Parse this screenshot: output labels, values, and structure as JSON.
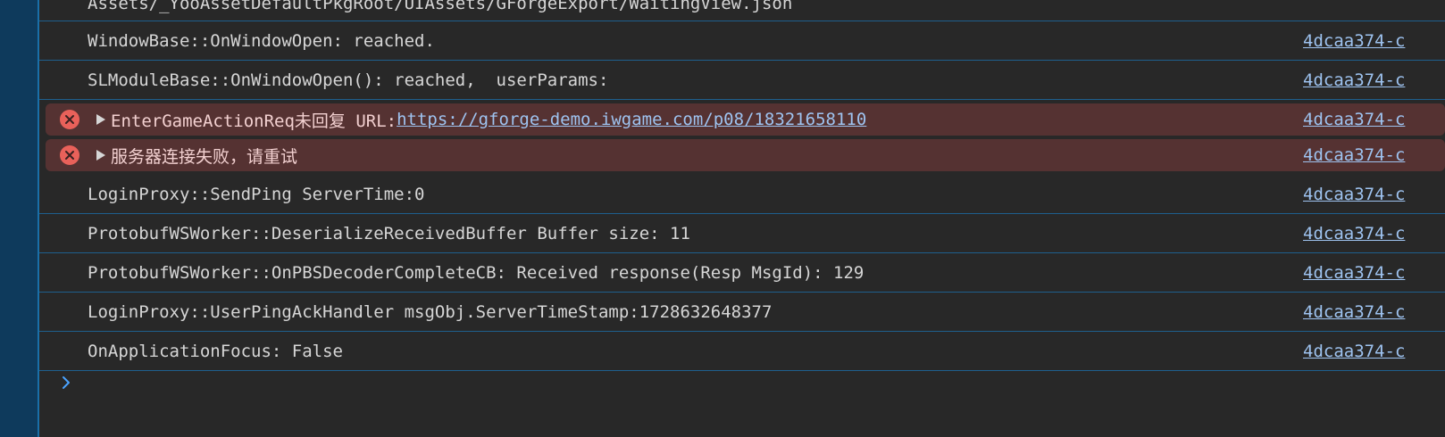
{
  "console": {
    "rows": [
      {
        "text": "Assets/_YooAssetDefaultPkgRoot/UIAssets/GForgeExport/WaitingView.json",
        "source": ""
      },
      {
        "text": "WindowBase::OnWindowOpen: reached.",
        "source": "4dcaa374-c"
      },
      {
        "text": "SLModuleBase::OnWindowOpen(): reached,  userParams:",
        "source": "4dcaa374-c"
      },
      {
        "text_prefix": "EnterGameActionReq未回复 URL:",
        "link": "https://gforge-demo.iwgame.com/p08/18321658110",
        "source": "4dcaa374-c",
        "level": "error"
      },
      {
        "text": "服务器连接失败，请重试",
        "source": "4dcaa374-c",
        "level": "error"
      },
      {
        "text": "LoginProxy::SendPing ServerTime:0",
        "source": "4dcaa374-c"
      },
      {
        "text": "ProtobufWSWorker::DeserializeReceivedBuffer Buffer size: 11",
        "source": "4dcaa374-c"
      },
      {
        "text": "ProtobufWSWorker::OnPBSDecoderCompleteCB: Received response(Resp MsgId): 129",
        "source": "4dcaa374-c"
      },
      {
        "text": "LoginProxy::UserPingAckHandler msgObj.ServerTimeStamp:1728632648377",
        "source": "4dcaa374-c"
      },
      {
        "text": "OnApplicationFocus: False",
        "source": "4dcaa374-c"
      }
    ]
  },
  "colors": {
    "background": "#282828",
    "error_bg": "#553232",
    "error_icon": "#e9615a",
    "link": "#9ec3f0",
    "separator": "#1e5f8e",
    "sidebar": "#0e3a5c"
  },
  "icons": {
    "error": "error-circle-x-icon",
    "expand": "expand-triangle-icon",
    "prompt": "chevron-right-prompt-icon"
  }
}
